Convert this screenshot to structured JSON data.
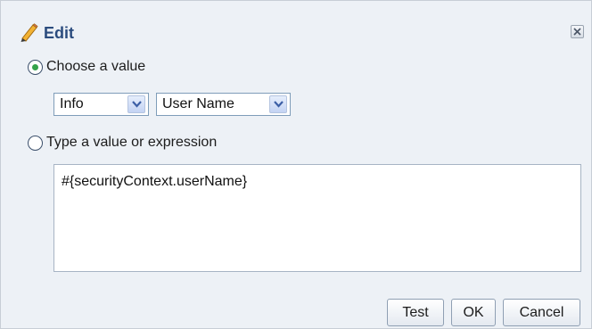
{
  "dialog": {
    "title": "Edit",
    "icons": {
      "title": "pencil-icon",
      "close": "close-icon"
    }
  },
  "choose_value": {
    "label": "Choose a value",
    "selected": true,
    "category_select": {
      "value": "Info"
    },
    "item_select": {
      "value": "User Name"
    }
  },
  "type_value": {
    "label": "Type a value or expression",
    "selected": false,
    "expression": "#{securityContext.userName}"
  },
  "buttons": {
    "test": "Test",
    "ok": "OK",
    "cancel": "Cancel"
  },
  "colors": {
    "background": "#edf1f6",
    "title_text": "#2b4c7e",
    "radio_checked": "#34a34a",
    "border": "#7f9db9"
  }
}
